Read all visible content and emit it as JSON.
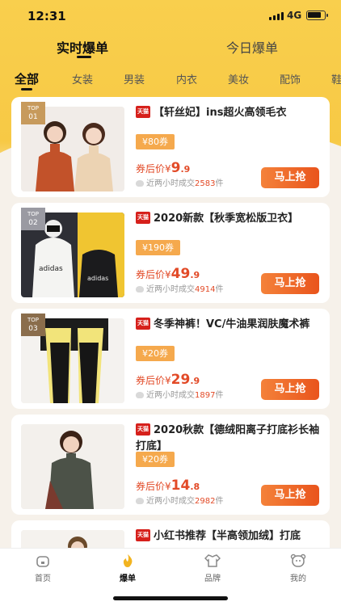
{
  "status": {
    "time": "12:31",
    "network": "4G"
  },
  "top_tabs": [
    {
      "label": "实时爆单",
      "active": true
    },
    {
      "label": "今日爆单",
      "active": false
    }
  ],
  "categories": [
    "全部",
    "女装",
    "男装",
    "内衣",
    "美妆",
    "配饰",
    "鞋"
  ],
  "products": [
    {
      "rank_word": "TOP",
      "rank": "01",
      "store": "天猫",
      "title": "【轩丝妃】ins超火高领毛衣",
      "coupon": "¥80券",
      "price_label": "券后价",
      "currency": "¥",
      "price_int": "9",
      "price_dec": ".9",
      "sold_prefix": "近两小时成交",
      "sold": "2583",
      "sold_suffix": "件",
      "buy": "马上抢"
    },
    {
      "rank_word": "TOP",
      "rank": "02",
      "store": "天猫",
      "title": "2020新款【秋季宽松版卫衣】",
      "coupon": "¥190券",
      "price_label": "券后价",
      "currency": "¥",
      "price_int": "49",
      "price_dec": ".9",
      "sold_prefix": "近两小时成交",
      "sold": "4914",
      "sold_suffix": "件",
      "buy": "马上抢"
    },
    {
      "rank_word": "TOP",
      "rank": "03",
      "store": "天猫",
      "title": "冬季神裤！VC/牛油果润肤魔术裤",
      "coupon": "¥20券",
      "price_label": "券后价",
      "currency": "¥",
      "price_int": "29",
      "price_dec": ".9",
      "sold_prefix": "近两小时成交",
      "sold": "1897",
      "sold_suffix": "件",
      "buy": "马上抢"
    },
    {
      "rank_word": "",
      "rank": "",
      "store": "天猫",
      "title": "2020秋款【德绒阳离子打底衫长袖打底】",
      "coupon": "¥20券",
      "price_label": "券后价",
      "currency": "¥",
      "price_int": "14",
      "price_dec": ".8",
      "sold_prefix": "近两小时成交",
      "sold": "2982",
      "sold_suffix": "件",
      "buy": "马上抢"
    },
    {
      "rank_word": "",
      "rank": "",
      "store": "天猫",
      "title": "小红书推荐【半高领加绒】打底"
    }
  ],
  "bottom_tabs": [
    {
      "label": "首页"
    },
    {
      "label": "爆单"
    },
    {
      "label": "品牌"
    },
    {
      "label": "我的"
    }
  ],
  "colors": {
    "accent": "#f7c945",
    "price": "#e24a27",
    "buy": "#e9541c",
    "coupon": "#f5a94d",
    "tmall": "#d6201b"
  }
}
